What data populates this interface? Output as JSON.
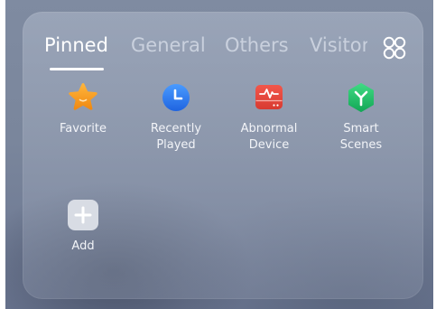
{
  "tabs": [
    {
      "label": "Pinned"
    },
    {
      "label": "General"
    },
    {
      "label": "Others"
    },
    {
      "label": "Visitor"
    }
  ],
  "active_tab": "Pinned",
  "tiles": [
    {
      "label": "Favorite",
      "icon": "star-icon"
    },
    {
      "label": "Recently\nPlayed",
      "icon": "clock-icon"
    },
    {
      "label": "Abnormal\nDevice",
      "icon": "device-alert-icon"
    },
    {
      "label": "Smart\nScenes",
      "icon": "smart-scenes-icon"
    },
    {
      "label": "Add",
      "icon": "plus-icon"
    }
  ],
  "colors": {
    "favorite": "#f39a1c",
    "recent": "#2f7df2",
    "abnormal": "#e8453c",
    "smart": "#23c26a"
  }
}
